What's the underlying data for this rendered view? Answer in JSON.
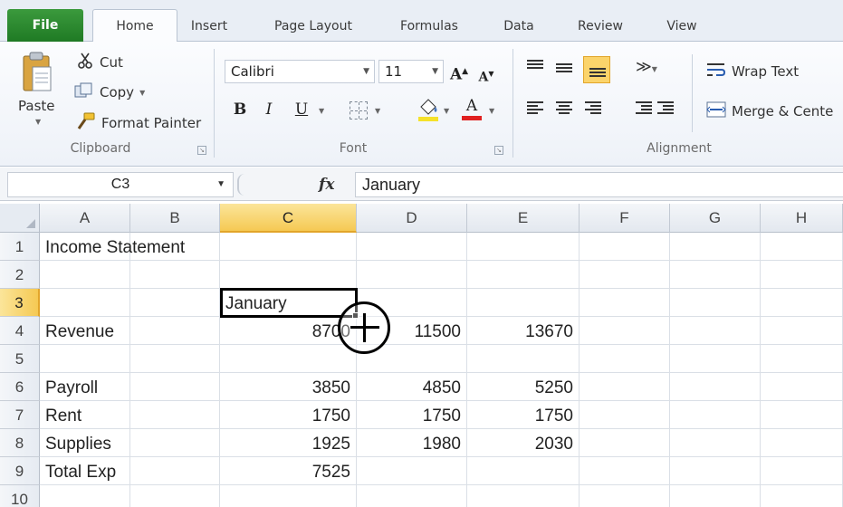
{
  "tabs": [
    {
      "label": "File"
    },
    {
      "label": "Home"
    },
    {
      "label": "Insert"
    },
    {
      "label": "Page Layout"
    },
    {
      "label": "Formulas"
    },
    {
      "label": "Data"
    },
    {
      "label": "Review"
    },
    {
      "label": "View"
    }
  ],
  "ribbon": {
    "clipboard": {
      "label": "Clipboard",
      "paste": "Paste",
      "cut": "Cut",
      "copy": "Copy",
      "format_painter": "Format Painter"
    },
    "font": {
      "label": "Font",
      "name": "Calibri",
      "size": "11",
      "bold": "B",
      "italic": "I",
      "underline": "U",
      "grow": "A",
      "shrink": "A",
      "font_color": "A"
    },
    "alignment": {
      "label": "Alignment",
      "wrap_text": "Wrap Text",
      "merge": "Merge & Cente"
    }
  },
  "formula_bar": {
    "name_box": "C3",
    "fx": "fx",
    "content": "January"
  },
  "grid": {
    "columns": [
      "A",
      "B",
      "C",
      "D",
      "E",
      "F",
      "G",
      "H"
    ],
    "rows": [
      "1",
      "2",
      "3",
      "4",
      "5",
      "6",
      "7",
      "8",
      "9",
      "10"
    ],
    "selected_cell": "C3",
    "cells": {
      "A1": "Income Statement",
      "C3": "January",
      "A4": "Revenue",
      "C4": "8700",
      "D4": "11500",
      "E4": "13670",
      "A6": "Payroll",
      "C6": "3850",
      "D6": "4850",
      "E6": "5250",
      "A7": "Rent",
      "C7": "1750",
      "D7": "1750",
      "E7": "1750",
      "A8": "Supplies",
      "C8": "1925",
      "D8": "1980",
      "E8": "2030",
      "A9": "Total Exp",
      "C9": "7525"
    }
  },
  "colors": {
    "file_tab": "#2b8a2f",
    "selection_header": "#f5c953",
    "ribbon_bg": "#eef2f8"
  }
}
